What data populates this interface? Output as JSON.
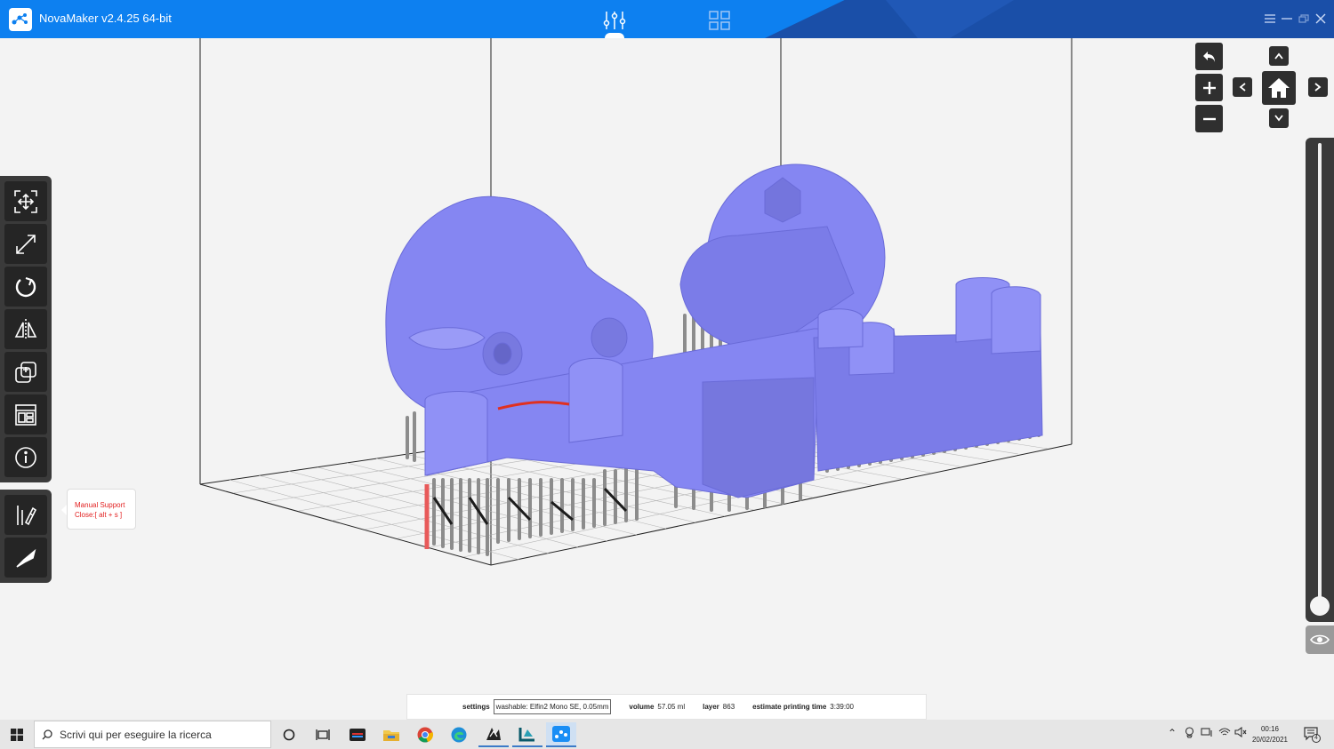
{
  "app": {
    "title": "NovaMaker v2.4.25 64-bit",
    "accent": "#0d80f0",
    "accent_dark": "#1a4fa8"
  },
  "header": {
    "tabs": [
      {
        "icon": "sliders-icon",
        "active": true
      },
      {
        "icon": "grid-icon",
        "active": false
      }
    ]
  },
  "window_controls": [
    "menu-icon",
    "minimize-icon",
    "restore-icon",
    "close-icon"
  ],
  "toolbar": {
    "tools": [
      {
        "name": "auto-arrange-tool",
        "icon": "move-arrows-icon"
      },
      {
        "name": "scale-tool",
        "icon": "scale-arrow-icon"
      },
      {
        "name": "rotate-tool",
        "icon": "rotate-icon"
      },
      {
        "name": "mirror-tool",
        "icon": "mirror-icon"
      },
      {
        "name": "duplicate-tool",
        "icon": "duplicate-icon"
      },
      {
        "name": "layout-tool",
        "icon": "layout-icon"
      },
      {
        "name": "info-tool",
        "icon": "info-icon"
      }
    ],
    "support_tools": [
      {
        "name": "manual-support-tool",
        "icon": "support-pen-icon"
      },
      {
        "name": "cut-tool",
        "icon": "knife-icon"
      }
    ]
  },
  "tooltip": {
    "line1": "Manual Support",
    "line2": "Close:[ alt + s ]",
    "color": "#e21e1e"
  },
  "status": {
    "settings_label": "settings",
    "settings_value": "washable: Elfin2 Mono SE, 0.05mm",
    "volume_label": "volume",
    "volume_value": "57.05  ml",
    "layer_label": "layer",
    "layer_value": "863",
    "time_label": "estimate printing time",
    "time_value": "3:39:00"
  },
  "layer_slider": {
    "position": 0
  },
  "model_colors": {
    "model": "#8586f2",
    "support": "#8c8c8c",
    "red": "#e03020"
  },
  "taskbar": {
    "search_placeholder": "Scrivi qui per eseguire la ricerca",
    "time": "00:16",
    "date": "20/02/2021",
    "notifications": "4",
    "apps": [
      "task-view-icon",
      "taskbar-app-icon",
      "file-explorer-icon",
      "chrome-icon",
      "edge-icon",
      "app-icon",
      "app-icon",
      "novamaker-icon"
    ]
  }
}
